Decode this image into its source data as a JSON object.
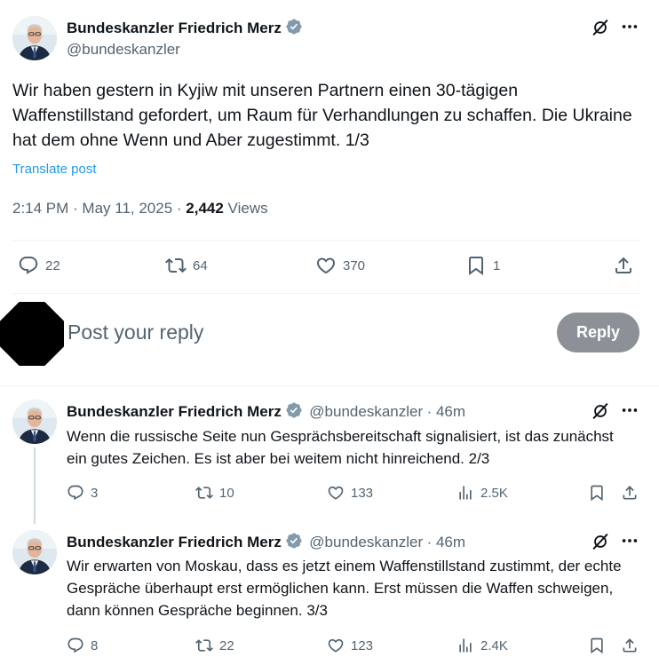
{
  "main_post": {
    "author_name": "Bundeskanzler Friedrich Merz",
    "author_handle": "@bundeskanzler",
    "text": "Wir haben gestern in Kyjiw mit unseren Partnern einen 30-tägigen Waffenstillstand gefordert, um Raum für Verhandlungen zu schaffen. Die Ukraine hat dem ohne Wenn und Aber zugestimmt. 1/3",
    "translate_label": "Translate post",
    "time": "2:14 PM · May 11, 2025 · ",
    "views_count": "2,442",
    "views_label": " Views",
    "replies": "22",
    "reposts": "64",
    "likes": "370",
    "bookmarks": "1"
  },
  "compose": {
    "placeholder": "Post your reply",
    "button_label": "Reply"
  },
  "replies": [
    {
      "author_name": "Bundeskanzler Friedrich Merz",
      "author_handle": "@bundeskanzler",
      "time": "· 46m",
      "text": "Wenn die russische Seite nun Gesprächsbereitschaft signalisiert, ist das zunächst ein gutes Zeichen. Es ist aber bei weitem nicht hinreichend. 2/3",
      "replies": "3",
      "reposts": "10",
      "likes": "133",
      "views": "2.5K"
    },
    {
      "author_name": "Bundeskanzler Friedrich Merz",
      "author_handle": "@bundeskanzler",
      "time": "· 46m",
      "text": "Wir erwarten von Moskau, dass es jetzt einem Waffenstillstand zustimmt, der echte Gespräche überhaupt erst ermöglichen kann. Erst müssen die Waffen schweigen, dann können Gespräche beginnen. 3/3",
      "replies": "8",
      "reposts": "22",
      "likes": "123",
      "views": "2.4K"
    }
  ],
  "colors": {
    "accent": "#1d9bf0",
    "text": "#0f1419",
    "muted": "#536471",
    "reply_button": "#8b9196",
    "verified": "#829aab"
  }
}
